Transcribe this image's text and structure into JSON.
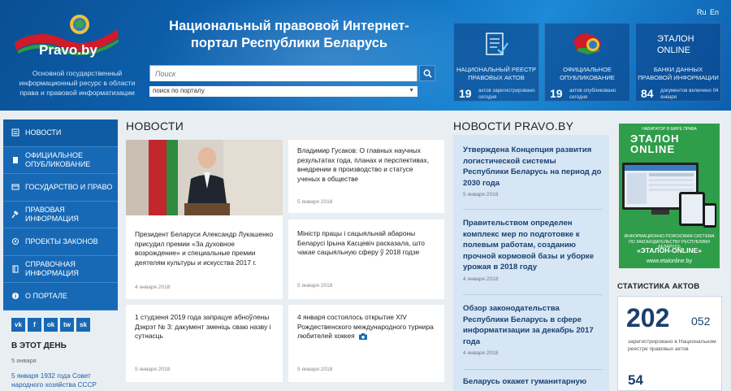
{
  "header": {
    "logo_text": "Pravo.by",
    "tagline": "Основной государственный информационный ресурс в области права и правовой информатизации",
    "title": "Национальный правовой Интернет-портал Республики Беларусь",
    "search": {
      "placeholder": "Поиск",
      "scope": "поиск по порталу"
    },
    "langs": [
      "Ru",
      "En"
    ],
    "tiles": [
      {
        "label": "НАЦИОНАЛЬНЫЙ РЕЕСТР ПРАВОВЫХ АКТОВ",
        "count": "19",
        "caption": "актов зарегистрировано сегодня",
        "icon": "document-check-icon"
      },
      {
        "label": "ОФИЦИАЛЬНОЕ ОПУБЛИКОВАНИЕ",
        "count": "19",
        "caption": "актов опубликовано сегодня",
        "icon": "map-emblem-icon"
      },
      {
        "label": "БАНКИ ДАННЫХ ПРАВОВОЙ ИНФОРМАЦИИ",
        "count": "84",
        "caption": "документов включено 04 января",
        "icon": "etalon-online-logo",
        "logo_text": "ЭТАЛОН ONLINE"
      }
    ]
  },
  "sidebar": {
    "items": [
      {
        "label": "НОВОСТИ",
        "icon": "news-icon"
      },
      {
        "label": "ОФИЦИАЛЬНОЕ ОПУБЛИКОВАНИЕ",
        "icon": "publish-icon"
      },
      {
        "label": "ГОСУДАРСТВО И ПРАВО",
        "icon": "state-icon"
      },
      {
        "label": "ПРАВОВАЯ ИНФОРМАЦИЯ",
        "icon": "gavel-icon"
      },
      {
        "label": "ПРОЕКТЫ ЗАКОНОВ",
        "icon": "project-icon"
      },
      {
        "label": "СПРАВОЧНАЯ ИНФОРМАЦИЯ",
        "icon": "book-icon"
      },
      {
        "label": "О ПОРТАЛЕ",
        "icon": "info-icon"
      }
    ],
    "social": [
      "vk",
      "f",
      "ok",
      "tw",
      "sk"
    ],
    "today": {
      "title": "В ЭТОТ ДЕНЬ",
      "date": "5 января",
      "text": "5 января 1932 года Совет народного хозяйства СССР"
    }
  },
  "news": {
    "title": "НОВОСТИ",
    "items": [
      {
        "text": "Президент Беларуси Александр Лукашенко присудил премии «За духовное возрождение» и специальные премии деятелям культуры и искусства 2017 г.",
        "date": "4 января 2018"
      },
      {
        "text": "Владимир Гусаков: О главных научных результатах года, планах и перспективах, внедрении в производство и статусе ученых в обществе",
        "date": "5 января 2018"
      },
      {
        "text": "Міністр працы і сацыяльнай абароны Беларусі Ірына Касцевіч расказала, што чакае сацыяльную сферу ў 2018 годзе",
        "date": "5 января 2018"
      },
      {
        "text": "1 студзеня 2019 года запрацуе абноўлены Дэкрэт № 3: дакумент зменіць сваю назву і сутнасць",
        "date": "5 января 2018"
      },
      {
        "text": "4 января состоялось открытие XIV Рождественского международного турнира любителей хоккея",
        "date": "5 января 2018"
      }
    ]
  },
  "pravoby_news": {
    "title": "НОВОСТИ PRAVO.BY",
    "items": [
      {
        "text": "Утверждена Концепция развития логистической системы Республики Беларусь на период до 2030 года",
        "date": "5 января 2018"
      },
      {
        "text": "Правительством определен комплекс мер по подготовке к полевым работам, созданию прочной кормовой базы и уборке урожая в 2018 году",
        "date": "4 января 2018"
      },
      {
        "text": "Обзор законодательства Республики Беларусь в сфере информатизации за декабрь 2017 года",
        "date": "4 января 2018"
      },
      {
        "text": "Беларусь окажет гуманитарную"
      }
    ]
  },
  "ad": {
    "header": "НАВИГАТОР В МИРЕ ПРАВА",
    "logo_line1": "ЭТАЛОН",
    "logo_line2": "ONLINE",
    "desc": "ИНФОРМАЦИОННО-ПОИСКОВАЯ СИСТЕМА ПО ЗАКОНОДАТЕЛЬСТВУ РЕСПУБЛИКИ БЕЛАРУСЬ",
    "name": "«ЭТАЛОН-ONLINE»",
    "url": "www.etalonline.by"
  },
  "stats": {
    "title": "СТАТИСТИКА АКТОВ",
    "big": "202",
    "big_small": "052",
    "label": "зарегистрировано в Национальном реестре правовых актов",
    "second": "54"
  },
  "colors": {
    "header_blue": "#0d6bbd",
    "nav_blue": "#1769b6",
    "ad_green": "#2f9d4a",
    "title_blue": "#1a3f6f"
  }
}
